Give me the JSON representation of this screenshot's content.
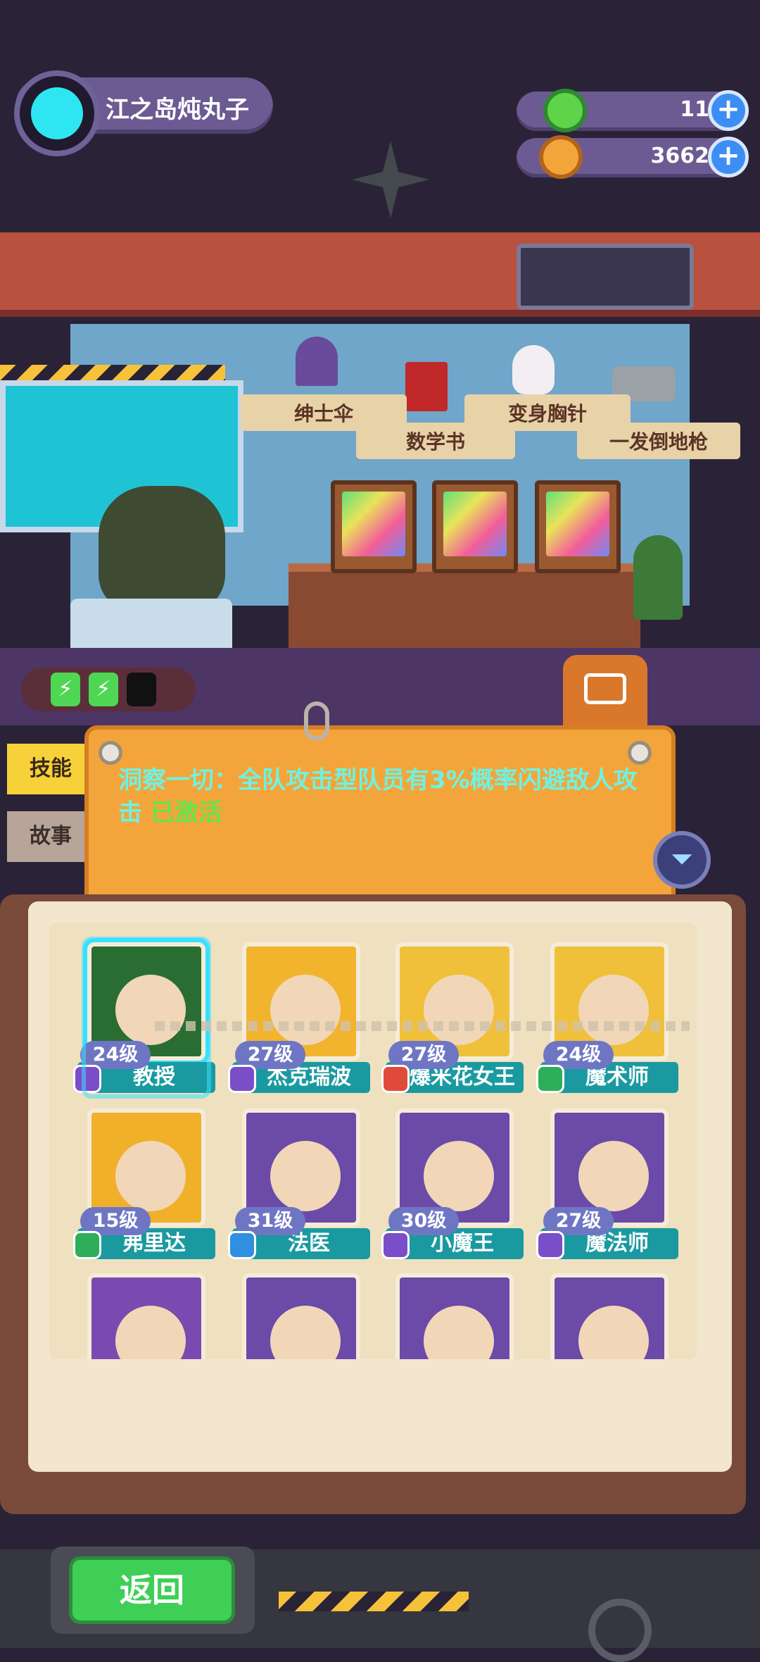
{
  "header": {
    "player_name": "江之岛炖丸子",
    "resources": [
      {
        "icon": "green-donut-coin-icon",
        "value": "11",
        "color": "#5fd34a"
      },
      {
        "icon": "orange-planet-coin-icon",
        "value": "3662",
        "color": "#f3a53b"
      }
    ],
    "plus_label": "+"
  },
  "shelf": {
    "items": [
      {
        "icon": "umbrella-icon",
        "label": "绅士伞"
      },
      {
        "icon": "math-book-icon",
        "label": "数学书"
      },
      {
        "icon": "skull-brooch-icon",
        "label": "变身胸针"
      },
      {
        "icon": "revolver-icon",
        "label": "一发倒地枪"
      }
    ]
  },
  "energy": {
    "charged": 2,
    "total": 3,
    "glyph": "⚡"
  },
  "side_tabs": {
    "skill": "技能",
    "story": "故事"
  },
  "skill_board": {
    "text": "洞察一切：全队攻击型队员有3%概率闪避敌人攻击",
    "status": "已激活"
  },
  "filter_icon": "filter-icon",
  "characters": [
    {
      "name": "教授",
      "level": "24级",
      "badge": "purple",
      "art": "#2a6d33",
      "selected": true
    },
    {
      "name": "杰克瑞波",
      "level": "27级",
      "badge": "purple",
      "art": "#f2b42d",
      "selected": false
    },
    {
      "name": "爆米花女王",
      "level": "27级",
      "badge": "red",
      "art": "#f0c03a",
      "selected": false
    },
    {
      "name": "魔术师",
      "level": "24级",
      "badge": "green",
      "art": "#f0c03a",
      "selected": false
    },
    {
      "name": "弗里达",
      "level": "15级",
      "badge": "green",
      "art": "#f0b02a",
      "selected": false
    },
    {
      "name": "法医",
      "level": "31级",
      "badge": "blue",
      "art": "#6b4aa8",
      "selected": false
    },
    {
      "name": "小魔王",
      "level": "30级",
      "badge": "purple",
      "art": "#6b4aa8",
      "selected": false
    },
    {
      "name": "魔法师",
      "level": "27级",
      "badge": "purple",
      "art": "#6b4aa8",
      "selected": false
    },
    {
      "name": "",
      "level": "",
      "badge": "",
      "art": "#7a4ab0",
      "selected": false
    },
    {
      "name": "",
      "level": "",
      "badge": "",
      "art": "#6b4aa8",
      "selected": false
    },
    {
      "name": "",
      "level": "",
      "badge": "",
      "art": "#6b4aa8",
      "selected": false
    },
    {
      "name": "",
      "level": "",
      "badge": "",
      "art": "#6b4aa8",
      "selected": false
    }
  ],
  "badge_colors": {
    "purple": "#7a4ec9",
    "red": "#e04a3a",
    "green": "#2fae5a",
    "blue": "#2f8fe0"
  },
  "back_button": "返回"
}
